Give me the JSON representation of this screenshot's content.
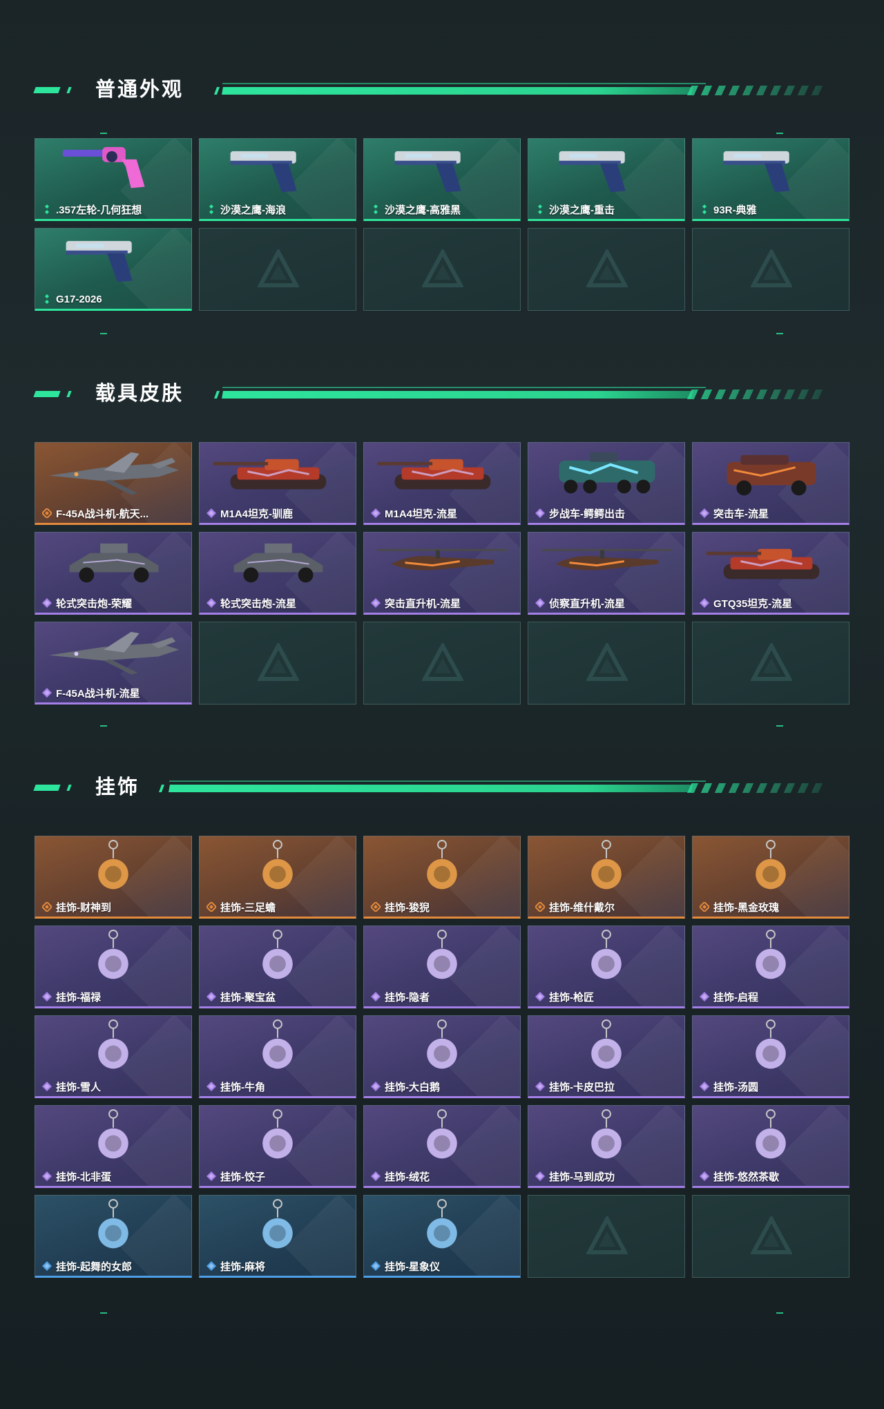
{
  "colors": {
    "accent": "#2ee59d",
    "rarity_green": "#2ee59d",
    "rarity_purple": "#a57fe8",
    "rarity_orange": "#e48a3c",
    "rarity_blue": "#4f9fe6"
  },
  "sections": {
    "weapons": {
      "title": "普通外观",
      "items": [
        {
          "label": ".357左轮-几何狂想",
          "rarity": "green",
          "icon": "revolver-icon"
        },
        {
          "label": "沙漠之鹰-海浪",
          "rarity": "green",
          "icon": "pistol-icon"
        },
        {
          "label": "沙漠之鹰-高雅黑",
          "rarity": "green",
          "icon": "pistol-icon"
        },
        {
          "label": "沙漠之鹰-重击",
          "rarity": "green",
          "icon": "pistol-icon"
        },
        {
          "label": "93R-典雅",
          "rarity": "green",
          "icon": "pistol-icon"
        },
        {
          "label": "G17-2026",
          "rarity": "green",
          "icon": "pistol-icon"
        }
      ]
    },
    "vehicles": {
      "title": "载具皮肤",
      "items": [
        {
          "label": "F-45A战斗机-航天...",
          "rarity": "orange",
          "icon": "jet-icon"
        },
        {
          "label": "M1A4坦克-驯鹿",
          "rarity": "purple",
          "icon": "tank-icon"
        },
        {
          "label": "M1A4坦克-流星",
          "rarity": "purple",
          "icon": "tank-icon"
        },
        {
          "label": "步战车-鳄鳄出击",
          "rarity": "purple",
          "icon": "apc-icon"
        },
        {
          "label": "突击车-流星",
          "rarity": "purple",
          "icon": "truck-icon"
        },
        {
          "label": "轮式突击炮-荣耀",
          "rarity": "purple",
          "icon": "buggy-icon"
        },
        {
          "label": "轮式突击炮-流星",
          "rarity": "purple",
          "icon": "buggy-icon"
        },
        {
          "label": "突击直升机-流星",
          "rarity": "purple",
          "icon": "helicopter-icon"
        },
        {
          "label": "侦察直升机-流星",
          "rarity": "purple",
          "icon": "helicopter-icon"
        },
        {
          "label": "GTQ35坦克-流星",
          "rarity": "purple",
          "icon": "tank-icon"
        },
        {
          "label": "F-45A战斗机-流星",
          "rarity": "purple",
          "icon": "jet-icon"
        }
      ]
    },
    "charms": {
      "title": "挂饰",
      "items": [
        {
          "label": "挂饰-财神到",
          "rarity": "orange",
          "icon": "charm-icon"
        },
        {
          "label": "挂饰-三足蟾",
          "rarity": "orange",
          "icon": "charm-icon"
        },
        {
          "label": "挂饰-狻猊",
          "rarity": "orange",
          "icon": "charm-icon"
        },
        {
          "label": "挂饰-维什戴尔",
          "rarity": "orange",
          "icon": "charm-icon"
        },
        {
          "label": "挂饰-黑金玫瑰",
          "rarity": "orange",
          "icon": "charm-icon"
        },
        {
          "label": "挂饰-福禄",
          "rarity": "purple",
          "icon": "charm-icon"
        },
        {
          "label": "挂饰-聚宝盆",
          "rarity": "purple",
          "icon": "charm-icon"
        },
        {
          "label": "挂饰-隐者",
          "rarity": "purple",
          "icon": "charm-icon"
        },
        {
          "label": "挂饰-枪匠",
          "rarity": "purple",
          "icon": "charm-icon"
        },
        {
          "label": "挂饰-启程",
          "rarity": "purple",
          "icon": "charm-icon"
        },
        {
          "label": "挂饰-雪人",
          "rarity": "purple",
          "icon": "charm-icon"
        },
        {
          "label": "挂饰-牛角",
          "rarity": "purple",
          "icon": "charm-icon"
        },
        {
          "label": "挂饰-大白鹅",
          "rarity": "purple",
          "icon": "charm-icon"
        },
        {
          "label": "挂饰-卡皮巴拉",
          "rarity": "purple",
          "icon": "charm-icon"
        },
        {
          "label": "挂饰-汤圆",
          "rarity": "purple",
          "icon": "charm-icon"
        },
        {
          "label": "挂饰-北非蛋",
          "rarity": "purple",
          "icon": "charm-icon"
        },
        {
          "label": "挂饰-饺子",
          "rarity": "purple",
          "icon": "charm-icon"
        },
        {
          "label": "挂饰-绒花",
          "rarity": "purple",
          "icon": "charm-icon"
        },
        {
          "label": "挂饰-马到成功",
          "rarity": "purple",
          "icon": "charm-icon"
        },
        {
          "label": "挂饰-悠然茶歇",
          "rarity": "purple",
          "icon": "charm-icon"
        },
        {
          "label": "挂饰-起舞的女郎",
          "rarity": "blue",
          "icon": "charm-icon"
        },
        {
          "label": "挂饰-麻将",
          "rarity": "blue",
          "icon": "charm-icon"
        },
        {
          "label": "挂饰-星象仪",
          "rarity": "blue",
          "icon": "charm-icon"
        }
      ]
    }
  }
}
